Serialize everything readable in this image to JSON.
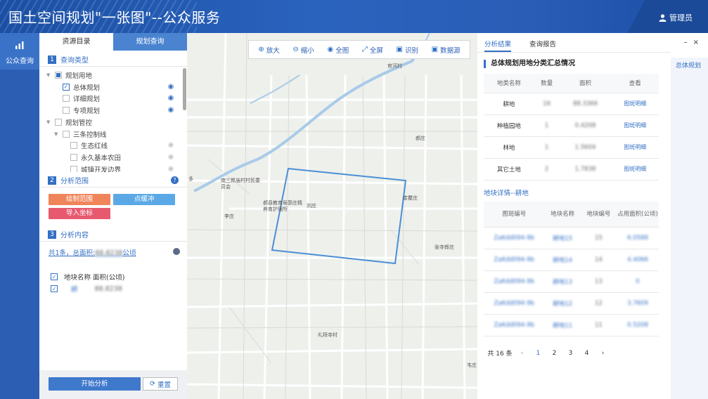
{
  "header": {
    "title": "国土空间规划\"一张图\"--公众服务",
    "user_label": "管理员"
  },
  "leftnav": {
    "item_label": "公众查询"
  },
  "panel": {
    "tabs": [
      "资源目录",
      "规划查询"
    ],
    "section1": {
      "num": "1",
      "title": "查询类型"
    },
    "tree": [
      {
        "label": "规划用地",
        "level": 0,
        "state": "partial",
        "arrow": true,
        "eye": ""
      },
      {
        "label": "总体规划",
        "level": 1,
        "state": "checked",
        "arrow": false,
        "eye": "blue"
      },
      {
        "label": "详细规划",
        "level": 1,
        "state": "unchecked",
        "arrow": false,
        "eye": "blue"
      },
      {
        "label": "专项规划",
        "level": 1,
        "state": "unchecked",
        "arrow": false,
        "eye": "blue"
      },
      {
        "label": "规划管控",
        "level": 0,
        "state": "unchecked",
        "arrow": true,
        "eye": ""
      },
      {
        "label": "三条控制线",
        "level": 1,
        "state": "unchecked",
        "arrow": true,
        "eye": ""
      },
      {
        "label": "生态红线",
        "level": 2,
        "state": "unchecked",
        "arrow": false,
        "eye": "grey"
      },
      {
        "label": "永久基本农田",
        "level": 2,
        "state": "unchecked",
        "arrow": false,
        "eye": "grey"
      },
      {
        "label": "城镇开发边界",
        "level": 2,
        "state": "unchecked",
        "arrow": false,
        "eye": "grey"
      }
    ],
    "section2": {
      "num": "2",
      "title": "分析范围",
      "help": "?"
    },
    "buttons": {
      "draw": "绘制范围",
      "buffer": "点缓冲",
      "import": "导入坐标"
    },
    "section3": {
      "num": "3",
      "title": "分析内容"
    },
    "summary": {
      "prefix": "共1条，总面积:",
      "value": "88.8238",
      "unit": "公顷"
    },
    "result_header": "地块名称 面积(公顷)",
    "result_row": {
      "name": "耕",
      "area": "88.8238"
    },
    "start": "开始分析",
    "reset": "重置"
  },
  "toolbar": [
    {
      "label": "放大",
      "icon": "zoom-in-icon",
      "glyph": "⊕"
    },
    {
      "label": "缩小",
      "icon": "zoom-out-icon",
      "glyph": "⊖"
    },
    {
      "label": "全图",
      "icon": "globe-icon",
      "glyph": "◉"
    },
    {
      "label": "全屏",
      "icon": "fullscreen-icon",
      "glyph": "⤢"
    },
    {
      "label": "识别",
      "icon": "identify-icon",
      "glyph": "▣"
    },
    {
      "label": "数据源",
      "icon": "datasource-icon",
      "glyph": "▣"
    }
  ],
  "map_labels": [
    "官河村",
    "南三郎庙村村民委员会",
    "郝县教育局郭庄精养育护理所",
    "刘庄",
    "李庄",
    "郝庄",
    "崔瞿庄",
    "张寺郎庄",
    "礼拜寺村",
    "韦庄",
    "多"
  ],
  "right": {
    "tabs": [
      "分析结果",
      "查询报告"
    ],
    "controls": [
      "–",
      "×"
    ],
    "sum_title": "总体规划用地分类汇总情况",
    "side_tab": "总体规划",
    "table1": {
      "headers": [
        "地类名称",
        "数量",
        "面积",
        "查看"
      ],
      "rows": [
        [
          "耕地",
          "16",
          "88.3366",
          "图斑明细"
        ],
        [
          "种植园地",
          "1",
          "0.4208",
          "图斑明细"
        ],
        [
          "林地",
          "1",
          "1.5604",
          "图斑明细"
        ],
        [
          "其它土地",
          "2",
          "1.7838",
          "图斑明细"
        ]
      ]
    },
    "sub_title": "地块详情--耕地",
    "table2": {
      "headers": [
        "图斑编号",
        "地块名称",
        "地块编号",
        "占用面积(公顷)"
      ],
      "rows": [
        [
          "ZaKdd094-9b",
          "耕地15",
          "15",
          "6.0588"
        ],
        [
          "ZaKdd094-9b",
          "耕地14",
          "14",
          "4.4066"
        ],
        [
          "ZaKdd094-9b",
          "耕地13",
          "13",
          "0"
        ],
        [
          "ZaKdd094-9b",
          "耕地12",
          "12",
          "3.7609"
        ],
        [
          "ZaKdd094-9b",
          "耕地11",
          "11",
          "0.5208"
        ]
      ]
    },
    "pager": {
      "total": "共 16 条",
      "pages": [
        "1",
        "2",
        "3",
        "4"
      ],
      "current": "1",
      "prev": "‹",
      "next": "›"
    }
  },
  "colors": {
    "header": "#2a5db6",
    "accent": "#3470c4",
    "draw_btn": "#f0845a",
    "buffer_btn": "#5aa9e6",
    "import_btn": "#e6596f",
    "polygon": "#4a8fd6"
  }
}
